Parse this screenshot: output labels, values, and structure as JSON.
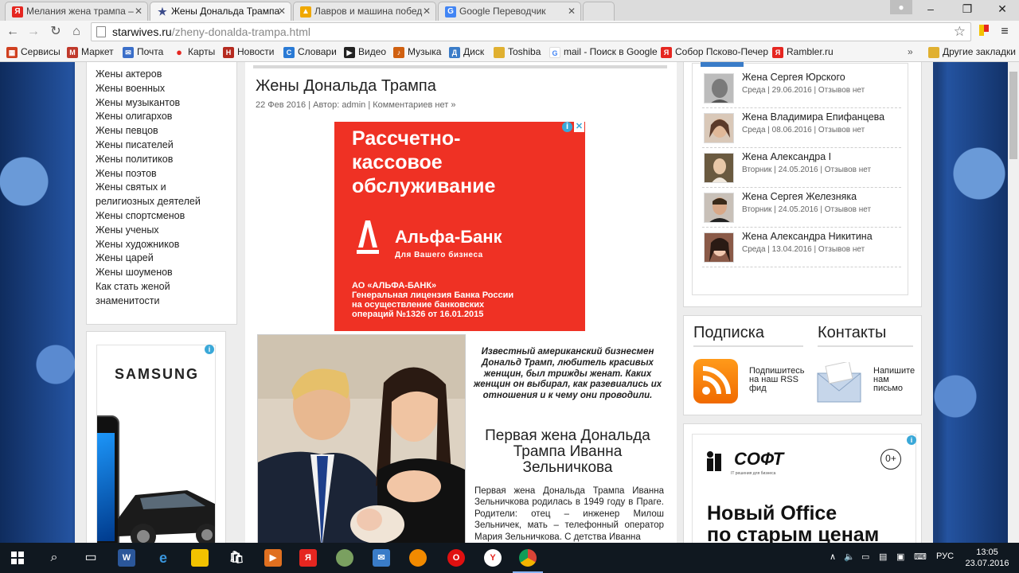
{
  "browser": {
    "tabs": [
      {
        "title": "Мелания жена трампа –",
        "favicon": "Я",
        "color": "#e52620"
      },
      {
        "title": "Жены Дональда Трампа",
        "favicon": "★",
        "color": "#3a4a8a"
      },
      {
        "title": "Лавров и машина побед",
        "favicon": "▲",
        "color": "#f0a800"
      },
      {
        "title": "Google Переводчик",
        "favicon": "G",
        "color": "#4285f4"
      }
    ],
    "close_glyph": "✕",
    "url_domain": "starwives.ru",
    "url_path": "/zheny-donalda-trampa.html",
    "bookmarks": [
      {
        "label": "Сервисы",
        "icon": "apps-icon",
        "color": "#d04020"
      },
      {
        "label": "Маркет",
        "icon": "market-icon",
        "color": "#c0392b"
      },
      {
        "label": "Почта",
        "icon": "mail-icon",
        "color": "#3b6fc9"
      },
      {
        "label": "Карты",
        "icon": "map-pin-icon",
        "color": "#e52620"
      },
      {
        "label": "Новости",
        "icon": "news-icon",
        "color": "#b52a1f"
      },
      {
        "label": "Словари",
        "icon": "dictionary-icon",
        "color": "#2a7ad5"
      },
      {
        "label": "Видео",
        "icon": "video-icon",
        "color": "#222222"
      },
      {
        "label": "Музыка",
        "icon": "music-icon",
        "color": "#d06010"
      },
      {
        "label": "Диск",
        "icon": "disk-icon",
        "color": "#3a7cc8"
      },
      {
        "label": "Toshiba",
        "icon": "folder-icon",
        "color": "#e0b030"
      },
      {
        "label": "mail - Поиск в Google",
        "icon": "google-icon",
        "color": "#4285f4"
      },
      {
        "label": "Собор Псково-Печер",
        "icon": "yandex-icon",
        "color": "#e52620"
      },
      {
        "label": "Rambler.ru",
        "icon": "yandex-icon",
        "color": "#e52620"
      }
    ],
    "bookmarks_more": "»",
    "other_bookmarks": "Другие закладки"
  },
  "sidebar": {
    "categories": [
      "Жены актеров",
      "Жены военных",
      "Жены музыкантов",
      "Жены олигархов",
      "Жены певцов",
      "Жены писателей",
      "Жены политиков",
      "Жены поэтов",
      "Жены святых и",
      "религиозных деятелей",
      "Жены спортсменов",
      "Жены ученых",
      "Жены художников",
      "Жены царей",
      "Жены шоуменов",
      "Как стать женой",
      "знаменитости"
    ],
    "ad_brand": "SAMSUNG"
  },
  "article": {
    "title": "Жены Дональда Трампа",
    "meta": "22 Фев 2016 | Автор: admin | Комментариев нет »",
    "ad": {
      "headline": [
        "Рассчетно-",
        "кассовое",
        "обслуживание"
      ],
      "bank_name": "Альфа-Банк",
      "bank_sub": "Для Вашего бизнеса",
      "legal": [
        "АО «АЛЬФА-БАНК»",
        "Генеральная лицензия Банка России",
        "на осуществление банковских",
        "операций №1326 от 16.01.2015"
      ],
      "bg_color": "#ef3124"
    },
    "intro": "Известный американский бизнесмен Дональд Трамп, любитель красивых женщин, был трижды женат. Каких женщин он выбирал, как разевиались их отношения и к чему они проводили.",
    "subheading": "Первая жена Дональда Трампа Иванна Зельничкова",
    "body": "Первая жена Дональда Трампа Иванна Зельничкова родилась в 1949 году в Праге. Родители: отец – инженер Милош Зельничек, мать – телефонный оператор Мария Зельничкова. С детства Иванна"
  },
  "recent": [
    {
      "title": "Жена Сергея Юрского",
      "meta": "Среда | 29.06.2016 | Отзывов нет"
    },
    {
      "title": "Жена Владимира Епифанцева",
      "meta": "Среда | 08.06.2016 | Отзывов нет"
    },
    {
      "title": "Жена Александра I",
      "meta": "Вторник | 24.05.2016 | Отзывов нет"
    },
    {
      "title": "Жена Сергея Железняка",
      "meta": "Вторник | 24.05.2016 | Отзывов нет"
    },
    {
      "title": "Жена Александра Никитина",
      "meta": "Среда | 13.04.2016 | Отзывов нет"
    }
  ],
  "subscribe": {
    "heading": "Подписка",
    "rss_text": [
      "Подпишитесь",
      "на наш RSS",
      "фид"
    ],
    "contacts_heading": "Контакты",
    "contacts_text": [
      "Напишите",
      "нам",
      "письмо"
    ]
  },
  "ad_right": {
    "logo": "СОФТ",
    "tagline": "IT решения для бизнеса",
    "age": "0+",
    "headline": [
      "Новый Office",
      "по старым ценам"
    ]
  },
  "taskbar": {
    "lang": "РУС",
    "time": "13:05",
    "date": "23.07.2016"
  },
  "colors": {
    "accent_blue": "#3a7cc8",
    "alfa_red": "#ef3124",
    "rss_orange": "#f28a00"
  }
}
